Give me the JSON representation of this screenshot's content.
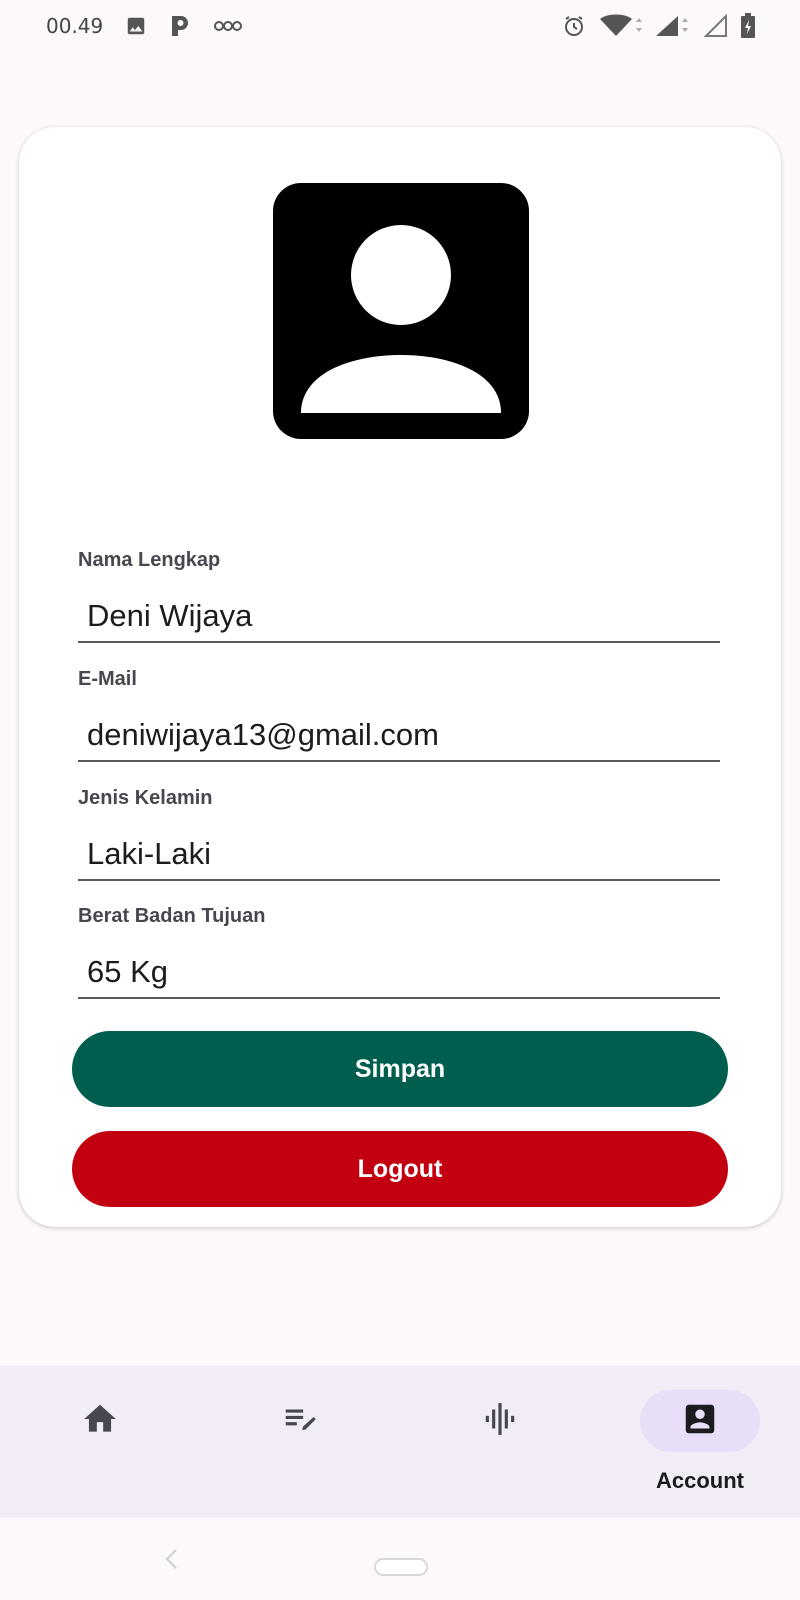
{
  "status_bar": {
    "time": "00.49",
    "left_icons": [
      "image-icon",
      "parking-icon",
      "voicemail-icon"
    ],
    "right_icons": [
      "alarm-icon",
      "wifi-icon",
      "signal-icon",
      "signal-empty-icon",
      "battery-icon"
    ]
  },
  "profile": {
    "avatar_icon": "account-box-icon",
    "fields": [
      {
        "label": "Nama Lengkap",
        "value": "Deni Wijaya"
      },
      {
        "label": "E-Mail",
        "value": "deniwijaya13@gmail.com"
      },
      {
        "label": "Jenis Kelamin",
        "value": "Laki-Laki"
      },
      {
        "label": "Berat Badan Tujuan",
        "value": "65 Kg"
      }
    ],
    "save_label": "Simpan",
    "logout_label": "Logout"
  },
  "bottom_nav": {
    "items": [
      {
        "icon": "home-icon",
        "label": ""
      },
      {
        "icon": "edit-note-icon",
        "label": ""
      },
      {
        "icon": "graphic-eq-icon",
        "label": ""
      },
      {
        "icon": "account-box-icon",
        "label": "Account",
        "active": true
      }
    ]
  },
  "colors": {
    "save": "#005e4e",
    "logout": "#c30010",
    "nav_active": "#e8def8",
    "nav_bg": "#f2ecf6"
  }
}
